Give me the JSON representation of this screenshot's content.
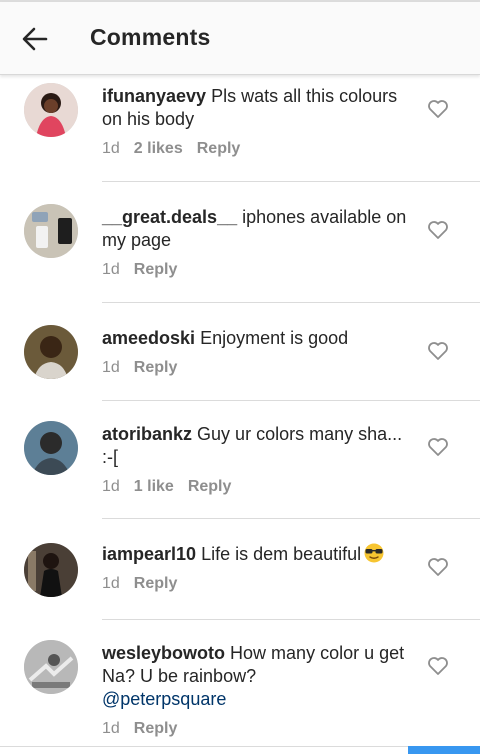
{
  "header": {
    "title": "Comments"
  },
  "icons": {
    "back": "arrow-left-icon",
    "like": "heart-outline-icon"
  },
  "colors": {
    "text": "#262626",
    "meta": "#8e8e8e",
    "mention": "#003569",
    "accent": "#3897f0"
  },
  "comments": [
    {
      "username": "ifunanyaevy",
      "text": "Pls wats all this colours on his body",
      "time": "1d",
      "likes": "2 likes",
      "reply": "Reply"
    },
    {
      "username": "__great.deals__",
      "text": "iphones available on my page",
      "time": "1d",
      "reply": "Reply"
    },
    {
      "username": "ameedoski",
      "text": "Enjoyment is good",
      "time": "1d",
      "reply": "Reply"
    },
    {
      "username": "atoribankz",
      "text": "Guy ur colors many sha... :-[",
      "time": "1d",
      "likes": "1 like",
      "reply": "Reply"
    },
    {
      "username": "iampearl10",
      "text": "Life is dem beautiful",
      "emoji": "sunglasses-emoji",
      "time": "1d",
      "reply": "Reply"
    },
    {
      "username": "wesleybowoto",
      "text": "How many color u get Na?  U be rainbow?",
      "mention": "@peterpsquare",
      "time": "1d",
      "reply": "Reply"
    }
  ]
}
